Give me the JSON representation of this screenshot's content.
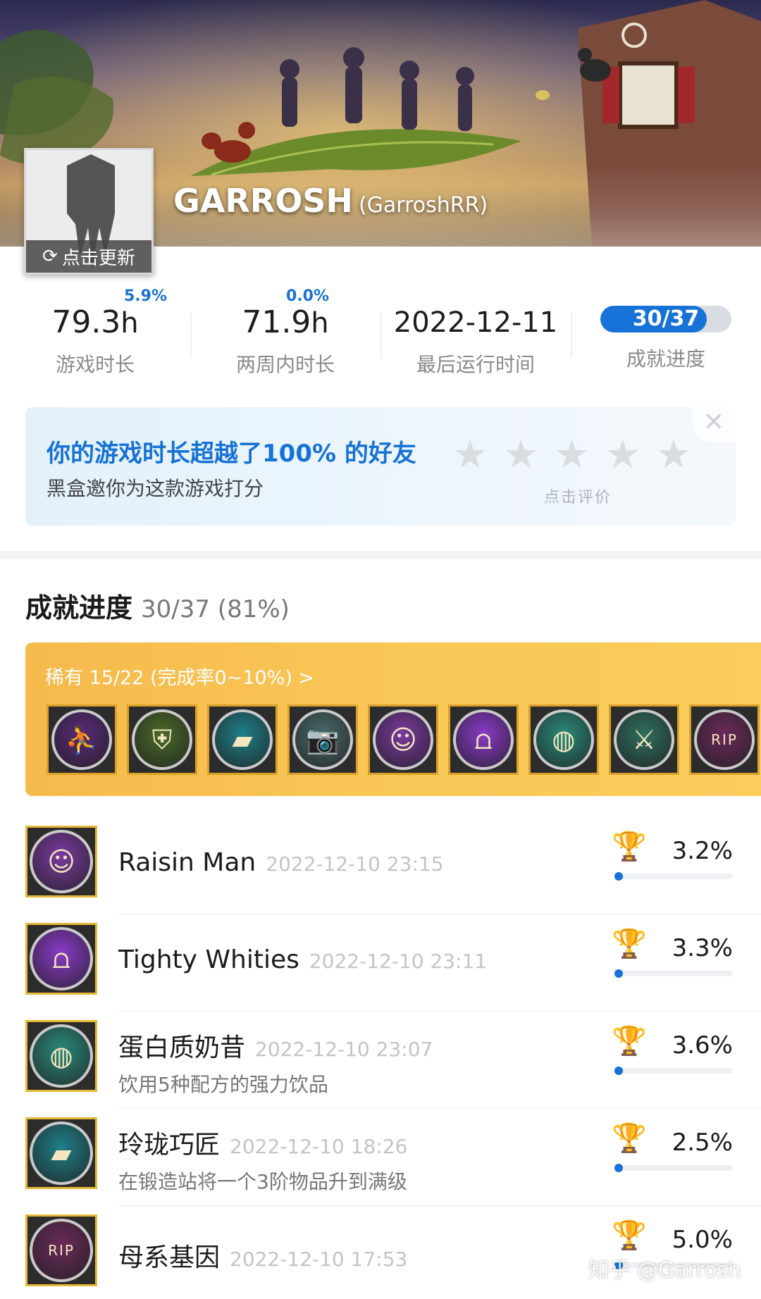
{
  "profile": {
    "name": "GARROSH",
    "handle": "(GarroshRR)",
    "refresh_label": "点击更新"
  },
  "stats": [
    {
      "value": "79.3",
      "unit": "h",
      "label": "游戏时长",
      "delta": "5.9%"
    },
    {
      "value": "71.9",
      "unit": "h",
      "label": "两周内时长",
      "delta": "0.0%"
    },
    {
      "value": "2022-12-11",
      "unit": "",
      "label": "最后运行时间",
      "delta": ""
    },
    {
      "value": "30/37",
      "unit": "",
      "label": "成就进度",
      "delta": "",
      "progress": 0.81
    }
  ],
  "rating": {
    "title": "你的游戏时长超越了100% 的好友",
    "subtitle": "黑盒邀你为这款游戏打分",
    "hint": "点击评价",
    "star_count": 5
  },
  "achievements": {
    "title": "成就进度",
    "count": "30/37 (81%)",
    "rare_label": "稀有 15/22 (完成率0~10%) >",
    "rare_badges": [
      {
        "icon": "basketball-hoop-icon",
        "color": "#5b2a7a",
        "glyph": "⛹"
      },
      {
        "icon": "shield-icon",
        "color": "#4a6a2a",
        "glyph": "⛨"
      },
      {
        "icon": "gold-bar-icon",
        "color": "#1f7f88",
        "glyph": "▰"
      },
      {
        "icon": "camera-icon",
        "color": "#4a6a6a",
        "glyph": "📷"
      },
      {
        "icon": "raisin-face-icon",
        "color": "#7a3aa0",
        "glyph": "☺"
      },
      {
        "icon": "underwear-icon",
        "color": "#8a3ac8",
        "glyph": "⩍"
      },
      {
        "icon": "milkshake-icon",
        "color": "#2a8a7a",
        "glyph": "◍"
      },
      {
        "icon": "crossed-spears-icon",
        "color": "#2f6f5f",
        "glyph": "⚔"
      },
      {
        "icon": "rip-lips-icon",
        "color": "#6a2a5a",
        "glyph": "RIP"
      }
    ],
    "items": [
      {
        "name": "Raisin Man",
        "time": "2022-12-10 23:15",
        "desc": "",
        "pct": "3.2%",
        "pct_value": 0.032,
        "icon": "raisin-face-icon",
        "color": "#7a3aa0",
        "glyph": "☺"
      },
      {
        "name": "Tighty Whities",
        "time": "2022-12-10 23:11",
        "desc": "",
        "pct": "3.3%",
        "pct_value": 0.033,
        "icon": "underwear-icon",
        "color": "#8a3ac8",
        "glyph": "⩍"
      },
      {
        "name": "蛋白质奶昔",
        "time": "2022-12-10 23:07",
        "desc": "饮用5种配方的强力饮品",
        "pct": "3.6%",
        "pct_value": 0.036,
        "icon": "milkshake-icon",
        "color": "#2a8a7a",
        "glyph": "◍"
      },
      {
        "name": "玲珑巧匠",
        "time": "2022-12-10 18:26",
        "desc": "在锻造站将一个3阶物品升到满级",
        "pct": "2.5%",
        "pct_value": 0.025,
        "icon": "gold-bar-icon",
        "color": "#1f7f88",
        "glyph": "▰"
      },
      {
        "name": "母系基因",
        "time": "2022-12-10 17:53",
        "desc": "",
        "pct": "5.0%",
        "pct_value": 0.05,
        "icon": "rip-lips-icon",
        "color": "#6a2a5a",
        "glyph": "RIP"
      }
    ]
  },
  "watermark": "知乎 @Garrosh"
}
